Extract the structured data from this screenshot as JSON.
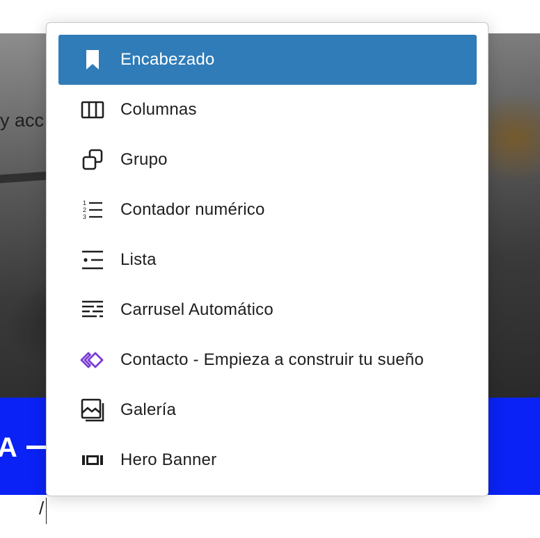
{
  "background": {
    "photo_text": "y acc",
    "banner_text": "A",
    "editor_input": "/"
  },
  "menu": {
    "items": [
      {
        "label": "Encabezado",
        "icon": "bookmark-icon",
        "selected": true
      },
      {
        "label": "Columnas",
        "icon": "columns-icon",
        "selected": false
      },
      {
        "label": "Grupo",
        "icon": "group-icon",
        "selected": false
      },
      {
        "label": "Contador numérico",
        "icon": "numbered-list-icon",
        "selected": false
      },
      {
        "label": "Lista",
        "icon": "list-icon",
        "selected": false
      },
      {
        "label": "Carrusel Automático",
        "icon": "text-lines-icon",
        "selected": false
      },
      {
        "label": "Contacto - Empieza a construir tu sueño",
        "icon": "diamond-icon",
        "selected": false
      },
      {
        "label": "Galería",
        "icon": "gallery-icon",
        "selected": false
      },
      {
        "label": "Hero Banner",
        "icon": "film-strip-icon",
        "selected": false
      }
    ]
  },
  "colors": {
    "selected_bg": "#2f7cb8",
    "banner_blue": "#0a22f5",
    "diamond_purple": "#7a3cd6"
  }
}
